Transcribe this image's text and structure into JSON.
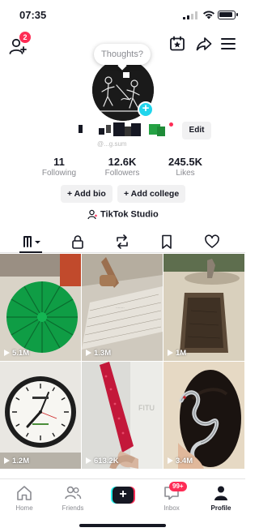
{
  "status_bar": {
    "time": "07:35"
  },
  "top_bar": {
    "add_friends_badge": "2"
  },
  "profile": {
    "thoughts_placeholder": "Thoughts?",
    "edit_label": "Edit",
    "handle": "@...g.sum",
    "stats": [
      {
        "value": "11",
        "label": "Following"
      },
      {
        "value": "12.6K",
        "label": "Followers"
      },
      {
        "value": "245.5K",
        "label": "Likes"
      }
    ],
    "add_bio_label": "+ Add bio",
    "add_college_label": "+ Add college",
    "studio_label": "TikTok Studio"
  },
  "videos": [
    {
      "views": "5.1M",
      "thumb": "green-pleated-fan"
    },
    {
      "views": "1.3M",
      "thumb": "sanding-board"
    },
    {
      "views": "1M",
      "thumb": "stone-fountain-pit"
    },
    {
      "views": "1.2M",
      "thumb": "wall-clock"
    },
    {
      "views": "613.2K",
      "thumb": "red-rhinestone-umbrella"
    },
    {
      "views": "3.4M",
      "thumb": "snake-hairpin"
    }
  ],
  "bottom_nav": {
    "home": "Home",
    "friends": "Friends",
    "inbox": "Inbox",
    "inbox_badge": "99+",
    "profile": "Profile"
  },
  "colors": {
    "accent_red": "#fe2c55",
    "accent_cyan": "#25f4ee",
    "text": "#161823",
    "muted": "#8a8b91"
  }
}
